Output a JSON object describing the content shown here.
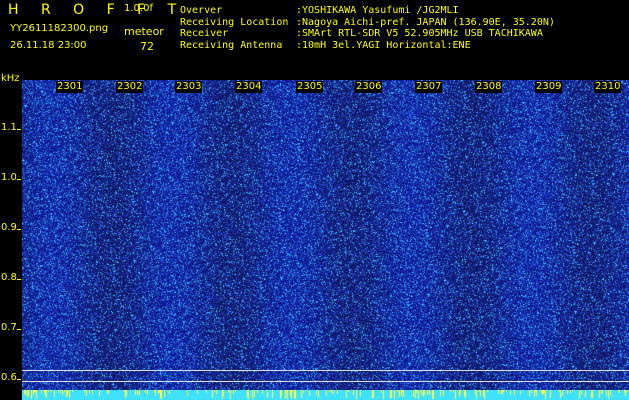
{
  "header": {
    "brand": "H R O F F T",
    "version": "1.0.0f",
    "filename": "YY2611182300.png",
    "meteor_label": "meteor",
    "timestamp": "26.11.18 23:00",
    "meteor_count": "72"
  },
  "info": [
    {
      "key": "Overver",
      "value": ":YOSHIKAWA Yasufumi /JG2MLI"
    },
    {
      "key": "Receiving Location",
      "value": ":Nagoya Aichi-pref. JAPAN (136.90E, 35.20N)"
    },
    {
      "key": "Receiver",
      "value": ":SMArt RTL-SDR V5 52.905MHz USB TACHIKAWA"
    },
    {
      "key": "Receiving Antenna",
      "value": ":10mH 3el.YAGI Horizontal:ENE"
    }
  ],
  "axis": {
    "y_unit": "kHz",
    "y_ticks": [
      "1.1",
      "1.0",
      "0.9",
      "0.8",
      "0.7",
      "0.6"
    ],
    "x_ticks": [
      "2301",
      "2302",
      "2303",
      "2304",
      "2305",
      "2306",
      "2307",
      "2308",
      "2309",
      "2310"
    ]
  },
  "colors": {
    "background": "#000000",
    "text": "#ffff00",
    "spectrogram_low": "#1020a0",
    "spectrogram_high": "#30c8ff",
    "noise_band": "#40e0ff"
  }
}
